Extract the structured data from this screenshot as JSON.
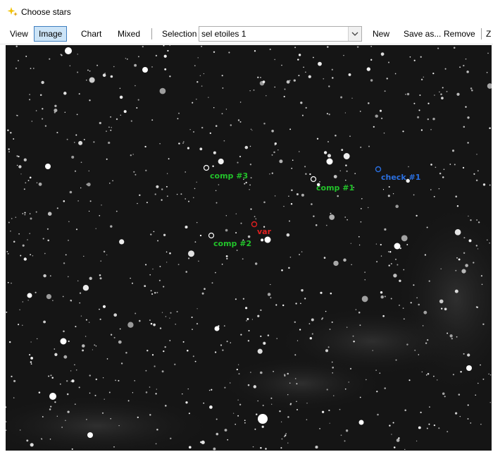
{
  "window": {
    "title": "Choose stars",
    "icon": "sparkle-star-icon"
  },
  "toolbar": {
    "view_label": "View",
    "image_label": "Image",
    "chart_label": "Chart",
    "mixed_label": "Mixed",
    "selection_label": "Selection",
    "selection_value": "sel etoiles 1",
    "new_label": "New",
    "save_as_label": "Save as...",
    "remove_label": "Remove",
    "overflow_label": "Z"
  },
  "markers": {
    "comp3": "comp #3",
    "comp1": "comp #1",
    "check1": "check #1",
    "var": "var",
    "comp2": "comp #2"
  },
  "colors": {
    "comp": "#22c22a",
    "check": "#2a6fe0",
    "var": "#e02020",
    "active": "#cce4f7"
  }
}
